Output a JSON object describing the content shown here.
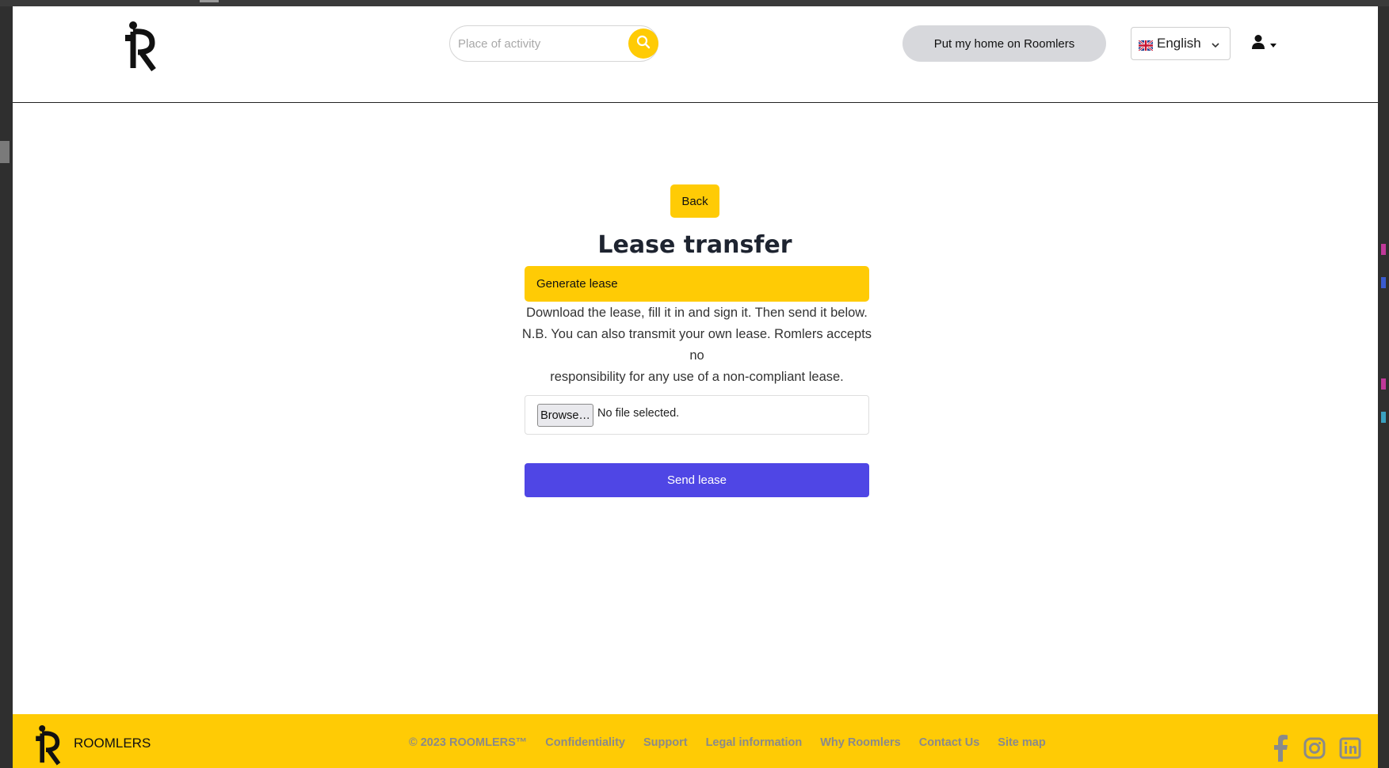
{
  "header": {
    "search_placeholder": "Place of activity",
    "put_home_label": "Put my home on Roomlers",
    "language_label": "English"
  },
  "main": {
    "back_label": "Back",
    "title": "Lease transfer",
    "generate_label": "Generate lease",
    "description_lines": [
      "Download the lease, fill it in and sign it. Then send it below.",
      "N.B. You can also transmit your own lease. Romlers accepts no",
      "responsibility for any use of a non-compliant lease."
    ],
    "browse_label": "Browse…",
    "file_status": "No file selected.",
    "send_label": "Send lease"
  },
  "footer": {
    "brand": "ROOMLERS",
    "copyright": "© 2023 ROOMLERS™",
    "links": [
      "Confidentiality",
      "Support",
      "Legal information",
      "Why Roomlers",
      "Contact Us",
      "Site map"
    ]
  },
  "icons": {
    "search": "search-icon",
    "user": "user-icon",
    "facebook": "facebook-icon",
    "instagram": "instagram-icon",
    "linkedin": "linkedin-icon"
  },
  "colors": {
    "accent": "#ffcb05",
    "primary_button": "#4f46e5",
    "pill_gray": "#d7d8dc",
    "footer_link": "#8a8a8a"
  }
}
